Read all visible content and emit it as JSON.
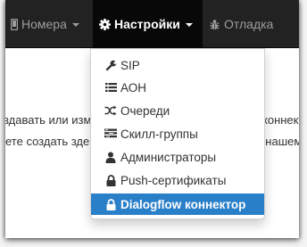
{
  "navbar": {
    "items": [
      {
        "label": "Номера",
        "icon": "mobile-phone-icon",
        "active": false
      },
      {
        "label": "Настройки",
        "icon": "gear-icon",
        "active": true
      },
      {
        "label": "Отладка",
        "icon": "bug-icon",
        "active": false
      }
    ]
  },
  "background_text": {
    "line1_left": "здавать или изм",
    "line1_right": "коннектор",
    "line2_left": "ете создать зде",
    "line2_right": "к нашему"
  },
  "dropdown": {
    "items": [
      {
        "label": "SIP",
        "icon": "wrench-icon"
      },
      {
        "label": "АОН",
        "icon": "list-icon"
      },
      {
        "label": "Очереди",
        "icon": "shuffle-icon"
      },
      {
        "label": "Скилл-группы",
        "icon": "stacked-list-icon"
      },
      {
        "label": "Администраторы",
        "icon": "user-icon"
      },
      {
        "label": "Push-сертификаты",
        "icon": "lock-icon"
      },
      {
        "label": "Dialogflow коннектор",
        "icon": "lock-icon",
        "active": true
      }
    ]
  },
  "colors": {
    "navbar_bg": "#222222",
    "active_nav_bg": "#080808",
    "highlight": "#2a7fc9"
  }
}
